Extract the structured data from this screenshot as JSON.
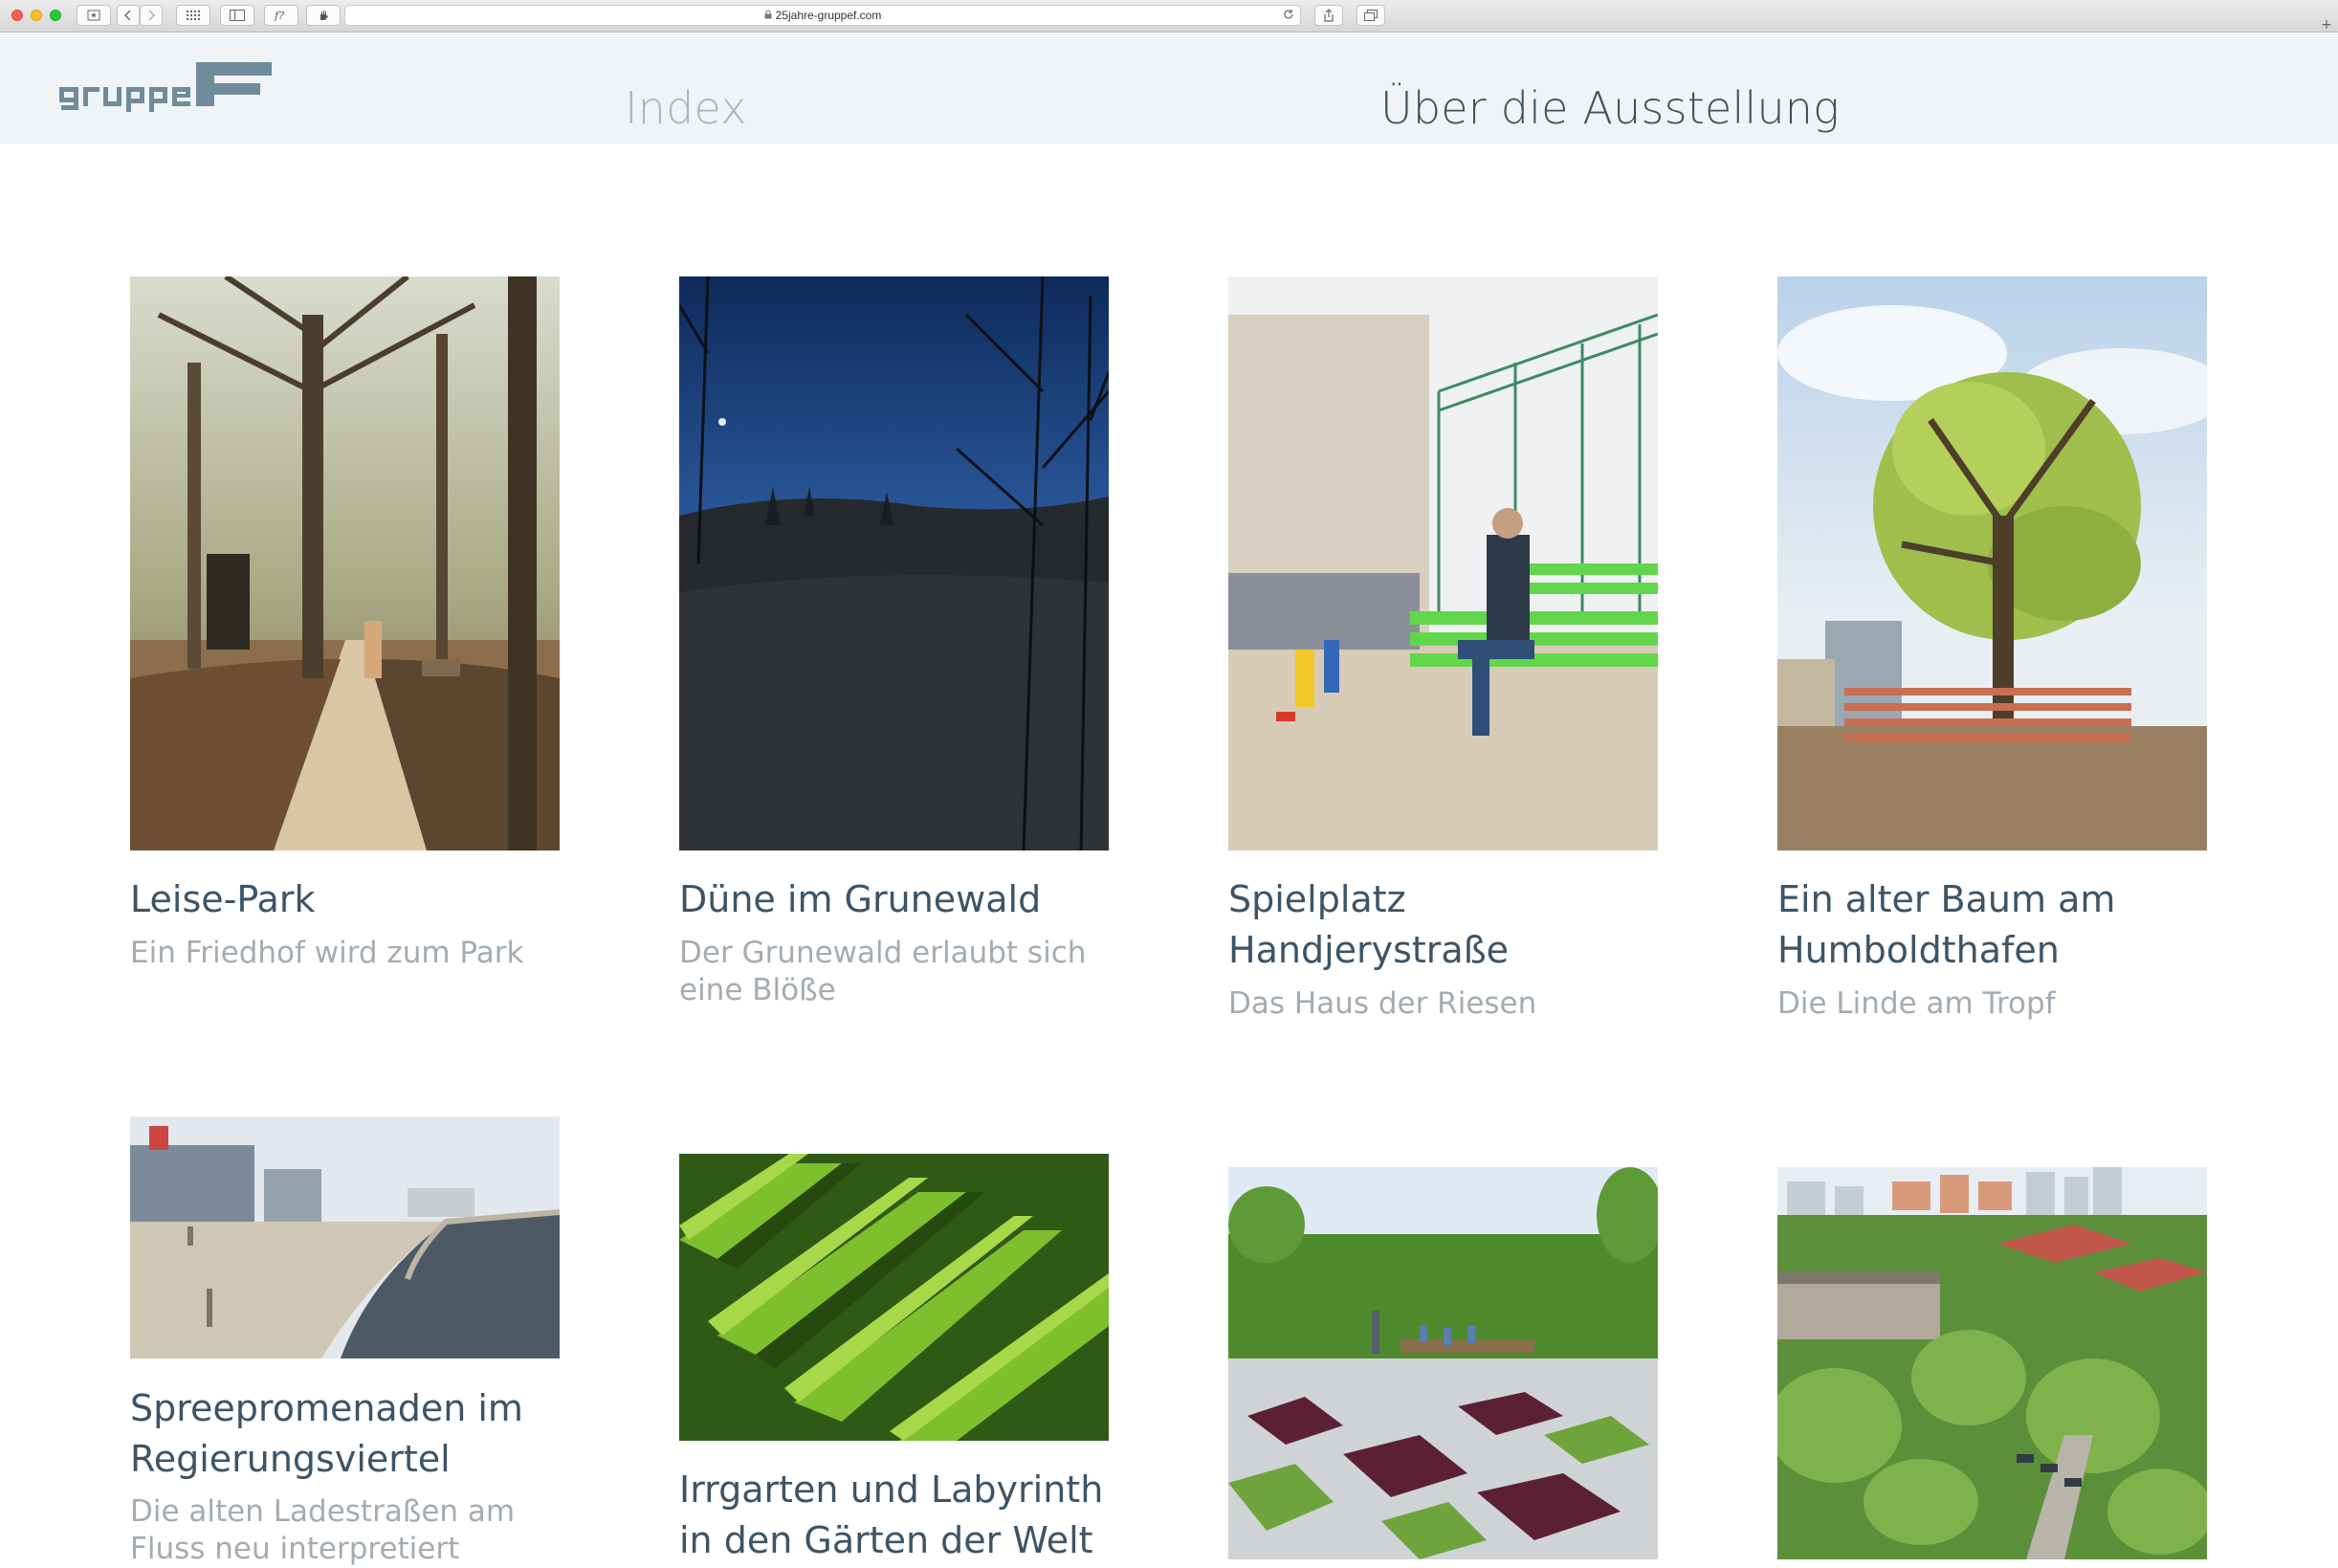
{
  "browser": {
    "url": "25jahre-gruppef.com",
    "icons": [
      "close-icon",
      "minimize-icon",
      "maximize-icon",
      "bookmark-icon",
      "back-icon",
      "forward-icon",
      "grid-icon",
      "sidebar-icon",
      "formula-icon",
      "hand-icon",
      "lock-icon",
      "reload-icon",
      "share-icon",
      "tabs-icon",
      "new-tab-icon"
    ]
  },
  "header": {
    "logo_alt": "gruppeF",
    "nav": [
      {
        "label": "Index",
        "active": false
      },
      {
        "label": "Über die Ausstellung",
        "active": true
      }
    ]
  },
  "colors": {
    "header_bg": "#f1f4f6",
    "nav_inactive": "#a8b6c2",
    "nav_active": "#3f5263",
    "card_title": "#3d5466",
    "card_subtitle": "#a3acb2",
    "logo": "#6f8b9c"
  },
  "projects": [
    {
      "title": "Leise-Park",
      "subtitle": "Ein Friedhof wird zum Park",
      "image": "park-path-photo"
    },
    {
      "title": "Düne im Grunewald",
      "subtitle": "Der Grunewald erlaubt sich eine Blöße",
      "image": "night-dune-photo"
    },
    {
      "title": "Spielplatz Handjerystraße",
      "subtitle": "Das Haus der Riesen",
      "image": "playground-bench-photo"
    },
    {
      "title": "Ein alter Baum am Humboldthafen",
      "subtitle": "Die Linde am Tropf",
      "image": "old-tree-photo"
    },
    {
      "title": "Spreepromenaden im Regierungsviertel",
      "subtitle": "Die alten Ladestraßen am Fluss neu interpretiert",
      "image": "river-promenade-photo"
    },
    {
      "title": "Irrgarten und Labyrinth in den Gärten der Welt",
      "subtitle": "",
      "image": "hedge-maze-photo"
    },
    {
      "title": "",
      "subtitle": "",
      "image": "garden-beds-photo"
    },
    {
      "title": "",
      "subtitle": "",
      "image": "aerial-housing-photo"
    }
  ]
}
